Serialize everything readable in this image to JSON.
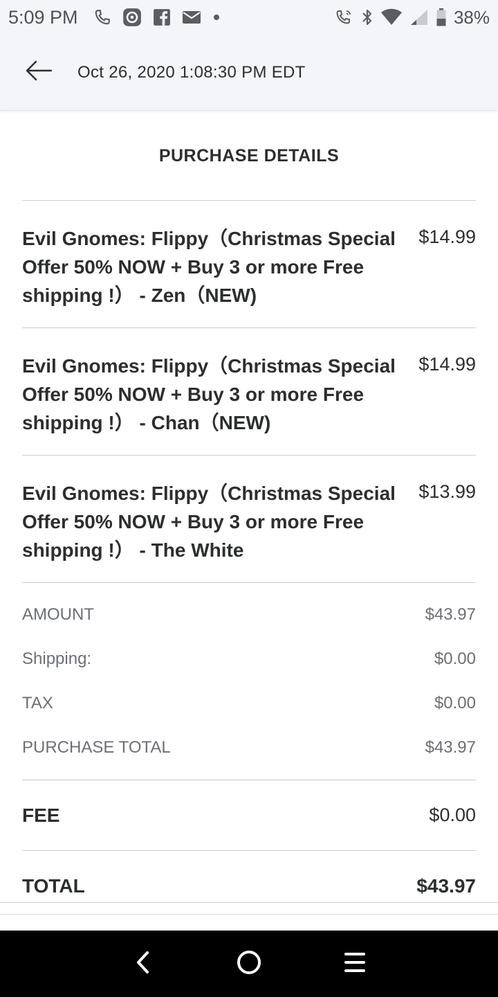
{
  "status_bar": {
    "time": "5:09 PM",
    "battery_percent": "38%",
    "icons_left": [
      "phone-icon",
      "media-icon",
      "facebook-icon",
      "mail-icon",
      "dot-icon"
    ],
    "icons_right": [
      "call-icon",
      "bluetooth-icon",
      "wifi-icon",
      "signal-icon",
      "battery-icon"
    ]
  },
  "header": {
    "back_icon": "back-arrow-icon",
    "title": "Oct 26, 2020 1:08:30 PM EDT"
  },
  "purchase": {
    "section_title": "PURCHASE DETAILS",
    "items": [
      {
        "name": "Evil Gnomes: Flippy（Christmas Special Offer 50% NOW + Buy 3 or more Free shipping !） - Zen（NEW)",
        "price": "$14.99"
      },
      {
        "name": "Evil Gnomes: Flippy（Christmas Special Offer 50% NOW + Buy 3 or more Free shipping !） - Chan（NEW)",
        "price": "$14.99"
      },
      {
        "name": "Evil Gnomes: Flippy（Christmas Special Offer 50% NOW + Buy 3 or more Free shipping !） - The White",
        "price": "$13.99"
      }
    ]
  },
  "summary": {
    "amount_label": "AMOUNT",
    "amount_value": "$43.97",
    "shipping_label": "Shipping:",
    "shipping_value": "$0.00",
    "tax_label": "TAX",
    "tax_value": "$0.00",
    "purchase_total_label": "PURCHASE TOTAL",
    "purchase_total_value": "$43.97"
  },
  "fee": {
    "label": "FEE",
    "value": "$0.00"
  },
  "total": {
    "label": "TOTAL",
    "value": "$43.97"
  },
  "nav_bar": {
    "icons": [
      "nav-back-icon",
      "nav-home-icon",
      "nav-menu-icon"
    ]
  }
}
